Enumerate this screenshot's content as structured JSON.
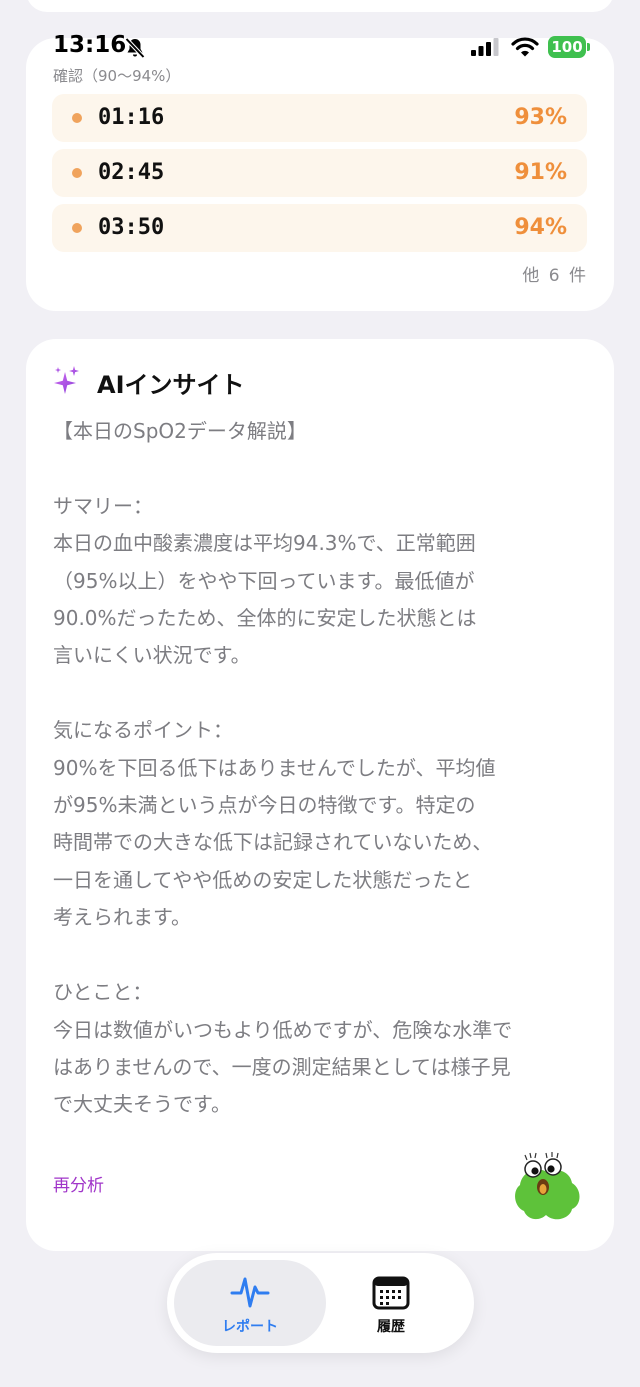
{
  "status_bar": {
    "time": "13:16",
    "battery": "100",
    "icons": [
      "bell-slash-icon",
      "signal-icon",
      "wifi-icon",
      "battery-icon"
    ]
  },
  "readings": {
    "caption": "確認（90〜94%）",
    "items": [
      {
        "time": "01:16",
        "value": "93%"
      },
      {
        "time": "02:45",
        "value": "91%"
      },
      {
        "time": "03:50",
        "value": "94%"
      }
    ],
    "more": "他 6 件",
    "dot_color": "#f0a35c",
    "value_color": "#ef8f3b"
  },
  "ai_insight": {
    "icon": "sparkle-icon",
    "title": "AIインサイト",
    "body": "【本日のSpO2データ解説】\n\nサマリー：\n本日の血中酸素濃度は平均94.3%で、正常範囲\n（95%以上）をやや下回っています。最低値が\n90.0%だったため、全体的に安定した状態とは\n言いにくい状況です。\n\n気になるポイント：\n90%を下回る低下はありませんでしたが、平均値\nが95%未満という点が今日の特徴です。特定の\n時間帯での大きな低下は記録されていないため、\n一日を通してやや低めの安定した状態だったと\n考えられます。\n\nひとこと：\n今日は数値がいつもより低めですが、危険な水準で\nはありませんので、一度の測定結果としては様子見\nで大丈夫そうです。",
    "reanalyze_label": "再分析",
    "link_color": "#a035c9"
  },
  "tab_bar": {
    "tabs": [
      {
        "label": "レポート",
        "icon": "heartbeat-icon",
        "selected": true
      },
      {
        "label": "履歴",
        "icon": "calendar-icon",
        "selected": false
      }
    ],
    "accent_color": "#2f7df0"
  }
}
